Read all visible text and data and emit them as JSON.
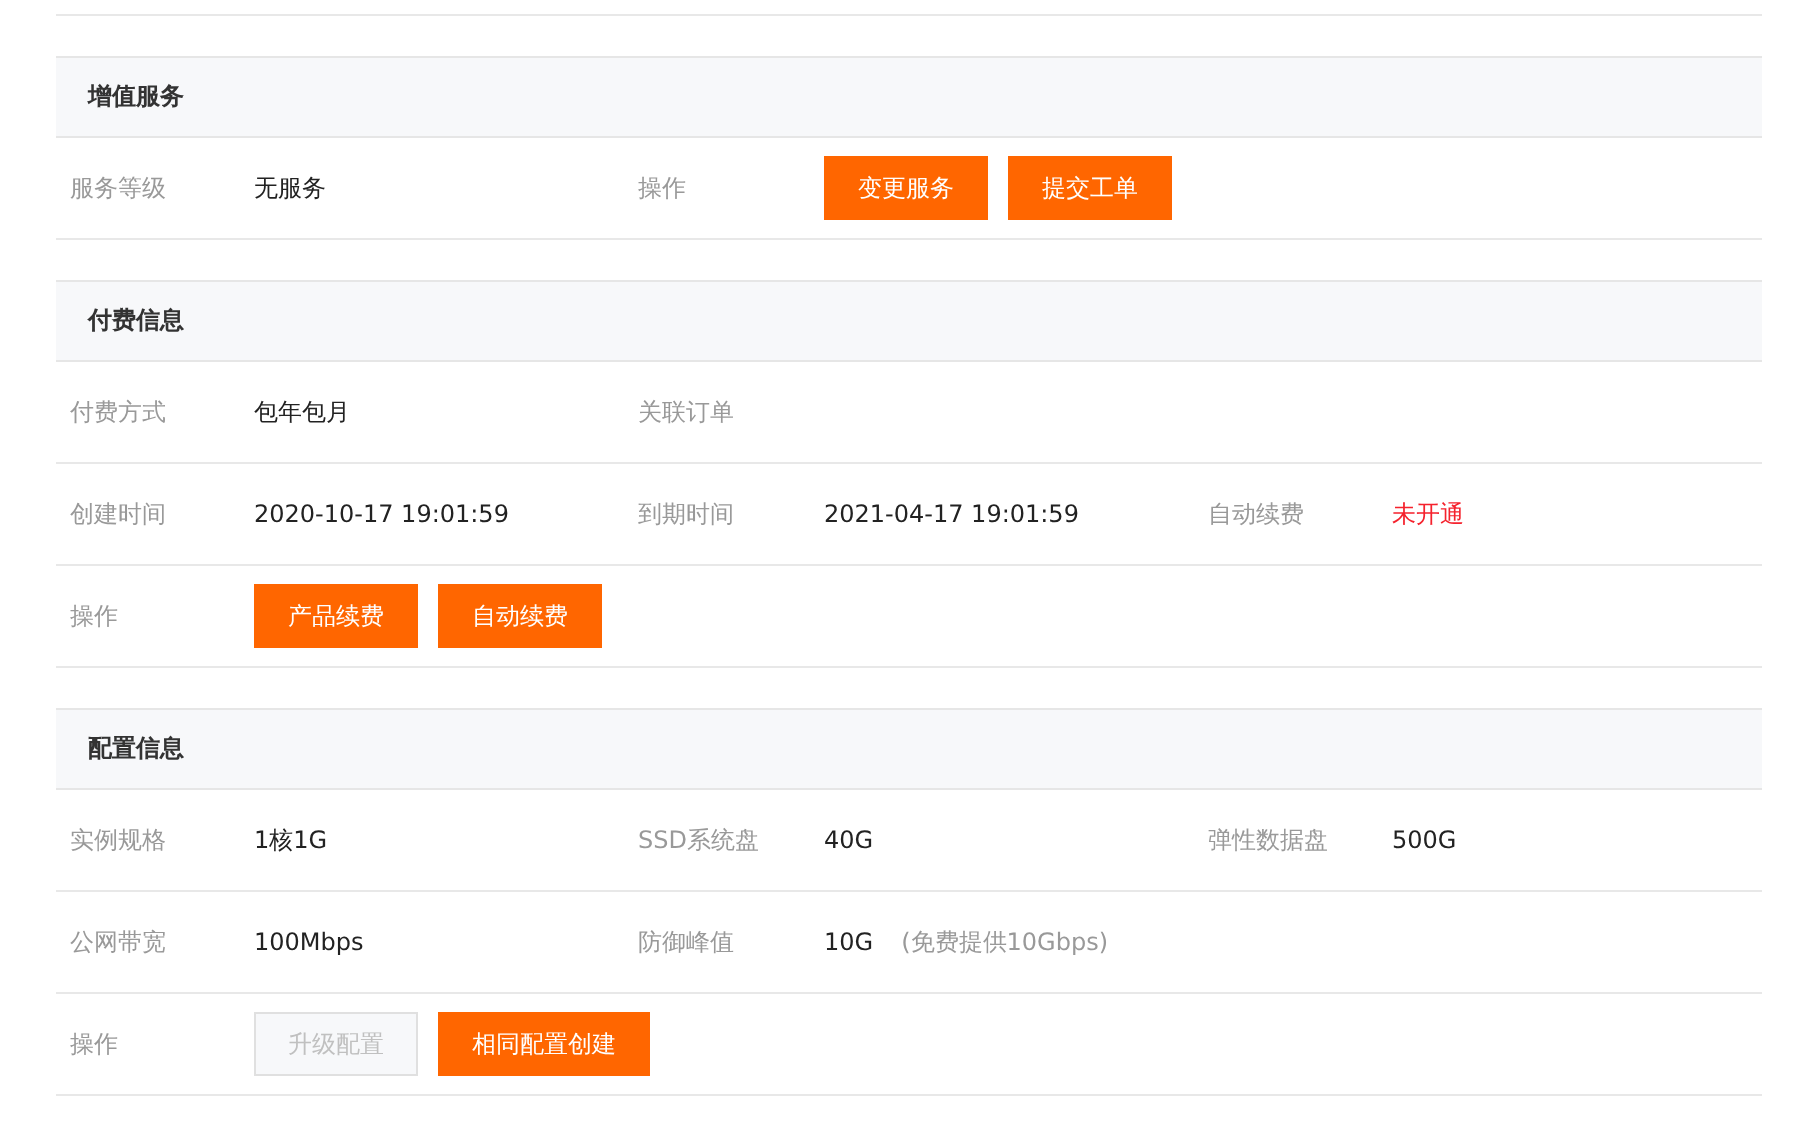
{
  "sections": [
    {
      "title": "增值服务",
      "rows": [
        {
          "fields": [
            {
              "label": "服务等级",
              "kind": "text",
              "value": "无服务"
            },
            {
              "label": "操作",
              "kind": "buttons",
              "buttons": [
                {
                  "label": "变更服务",
                  "disabled": false
                },
                {
                  "label": "提交工单",
                  "disabled": false
                }
              ]
            }
          ]
        }
      ]
    },
    {
      "title": "付费信息",
      "rows": [
        {
          "fields": [
            {
              "label": "付费方式",
              "kind": "text",
              "value": "包年包月"
            },
            {
              "label": "关联订单",
              "kind": "empty"
            }
          ]
        },
        {
          "fields": [
            {
              "label": "创建时间",
              "kind": "text",
              "value": "2020-10-17 19:01:59"
            },
            {
              "label": "到期时间",
              "kind": "text",
              "value": "2021-04-17 19:01:59"
            },
            {
              "label": "自动续费",
              "kind": "alert",
              "value": "未开通"
            }
          ]
        },
        {
          "fields": [
            {
              "label": "操作",
              "kind": "buttons",
              "buttons": [
                {
                  "label": "产品续费",
                  "disabled": false
                },
                {
                  "label": "自动续费",
                  "disabled": false
                }
              ]
            }
          ]
        }
      ]
    },
    {
      "title": "配置信息",
      "rows": [
        {
          "fields": [
            {
              "label": "实例规格",
              "kind": "text",
              "value": "1核1G"
            },
            {
              "label": "SSD系统盘",
              "kind": "text",
              "value": "40G"
            },
            {
              "label": "弹性数据盘",
              "kind": "text",
              "value": "500G"
            }
          ]
        },
        {
          "fields": [
            {
              "label": "公网带宽",
              "kind": "text",
              "value": "100Mbps"
            },
            {
              "label": "防御峰值",
              "kind": "text",
              "value": "10G",
              "note": "(免费提供10Gbps)"
            }
          ]
        },
        {
          "fields": [
            {
              "label": "操作",
              "kind": "buttons",
              "buttons": [
                {
                  "label": "升级配置",
                  "disabled": true
                },
                {
                  "label": "相同配置创建",
                  "disabled": false
                }
              ]
            }
          ]
        }
      ]
    }
  ]
}
